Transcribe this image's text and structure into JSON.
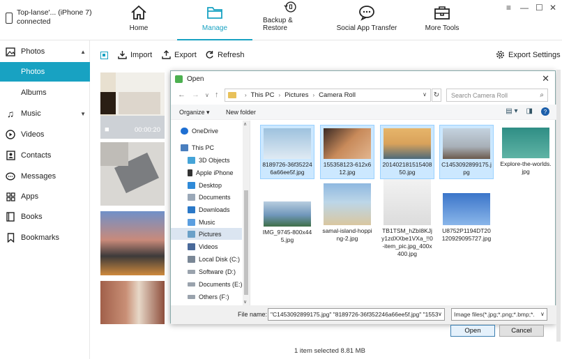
{
  "device": {
    "name": "Top-lanse'... (iPhone 7)",
    "status": "connected"
  },
  "nav_tabs": [
    {
      "label": "Home",
      "icon": "home-icon"
    },
    {
      "label": "Manage",
      "icon": "folder-icon",
      "active": true
    },
    {
      "label": "Backup & Restore",
      "icon": "backup-icon"
    },
    {
      "label": "Social App Transfer",
      "icon": "chat-icon"
    },
    {
      "label": "More Tools",
      "icon": "toolbox-icon"
    }
  ],
  "sidebar": {
    "items": [
      {
        "label": "Photos",
        "icon": "image-icon"
      },
      {
        "label": "Photos",
        "active": true
      },
      {
        "label": "Albums"
      },
      {
        "label": "Music",
        "icon": "music-icon"
      },
      {
        "label": "Videos",
        "icon": "play-icon"
      },
      {
        "label": "Contacts",
        "icon": "contact-icon"
      },
      {
        "label": "Messages",
        "icon": "message-icon"
      },
      {
        "label": "Apps",
        "icon": "apps-icon"
      },
      {
        "label": "Books",
        "icon": "book-icon"
      },
      {
        "label": "Bookmarks",
        "icon": "bookmark-icon"
      }
    ]
  },
  "toolbar": {
    "import": "Import",
    "export": "Export",
    "refresh": "Refresh",
    "export_settings": "Export Settings"
  },
  "thumbnail_video_duration": "00:00:20",
  "dialog": {
    "title": "Open",
    "path": [
      "This PC",
      "Pictures",
      "Camera Roll"
    ],
    "search_placeholder": "Search Camera Roll",
    "organize": "Organize",
    "new_folder": "New folder",
    "nav_items": [
      "OneDrive",
      "This PC",
      "3D Objects",
      "Apple iPhone",
      "Desktop",
      "Documents",
      "Downloads",
      "Music",
      "Pictures",
      "Videos",
      "Local Disk (C:)",
      "Software (D:)",
      "Documents (E:)",
      "Others (F:)"
    ],
    "files": [
      {
        "name": "8189726-36f352246a66ee5f.jpg",
        "selected": true,
        "color": "#8fb5d5"
      },
      {
        "name": "155358123-612x612.jpg",
        "selected": true,
        "color": "#c88a5a"
      },
      {
        "name": "20140218151540850.jpg",
        "selected": true,
        "color": "#d9a25b"
      },
      {
        "name": "C1453092899175.jpg",
        "selected": true,
        "color": "#b9c4cf"
      },
      {
        "name": "Explore-the-worlds.jpg",
        "selected": false,
        "color": "#3e9a8e"
      },
      {
        "name": "IMG_9745-800x445.jpg",
        "selected": false,
        "color": "#7fa2c2"
      },
      {
        "name": "samal-island-hopping-2.jpg",
        "selected": false,
        "color": "#c7b98c"
      },
      {
        "name": "TB1TSM_hZbI8KJjy1zdXXbe1VXa_!!0-item_pic.jpg_400x400.jpg",
        "selected": false,
        "color": "#e6e6e6"
      },
      {
        "name": "U8752P1194DT20120929095727.jpg",
        "selected": false,
        "color": "#4f7fcc"
      }
    ],
    "file_name_label": "File name:",
    "file_name_value": "\"C1453092899175.jpg\" \"8189726-36f352246a66ee5f.jpg\" \"1553",
    "file_type": "Image files(*.jpg;*.png;*.bmp;*.",
    "open_label": "Open",
    "cancel_label": "Cancel"
  },
  "status": "1 item selected 8.81 MB",
  "colors": {
    "accent": "#18a2c2"
  }
}
